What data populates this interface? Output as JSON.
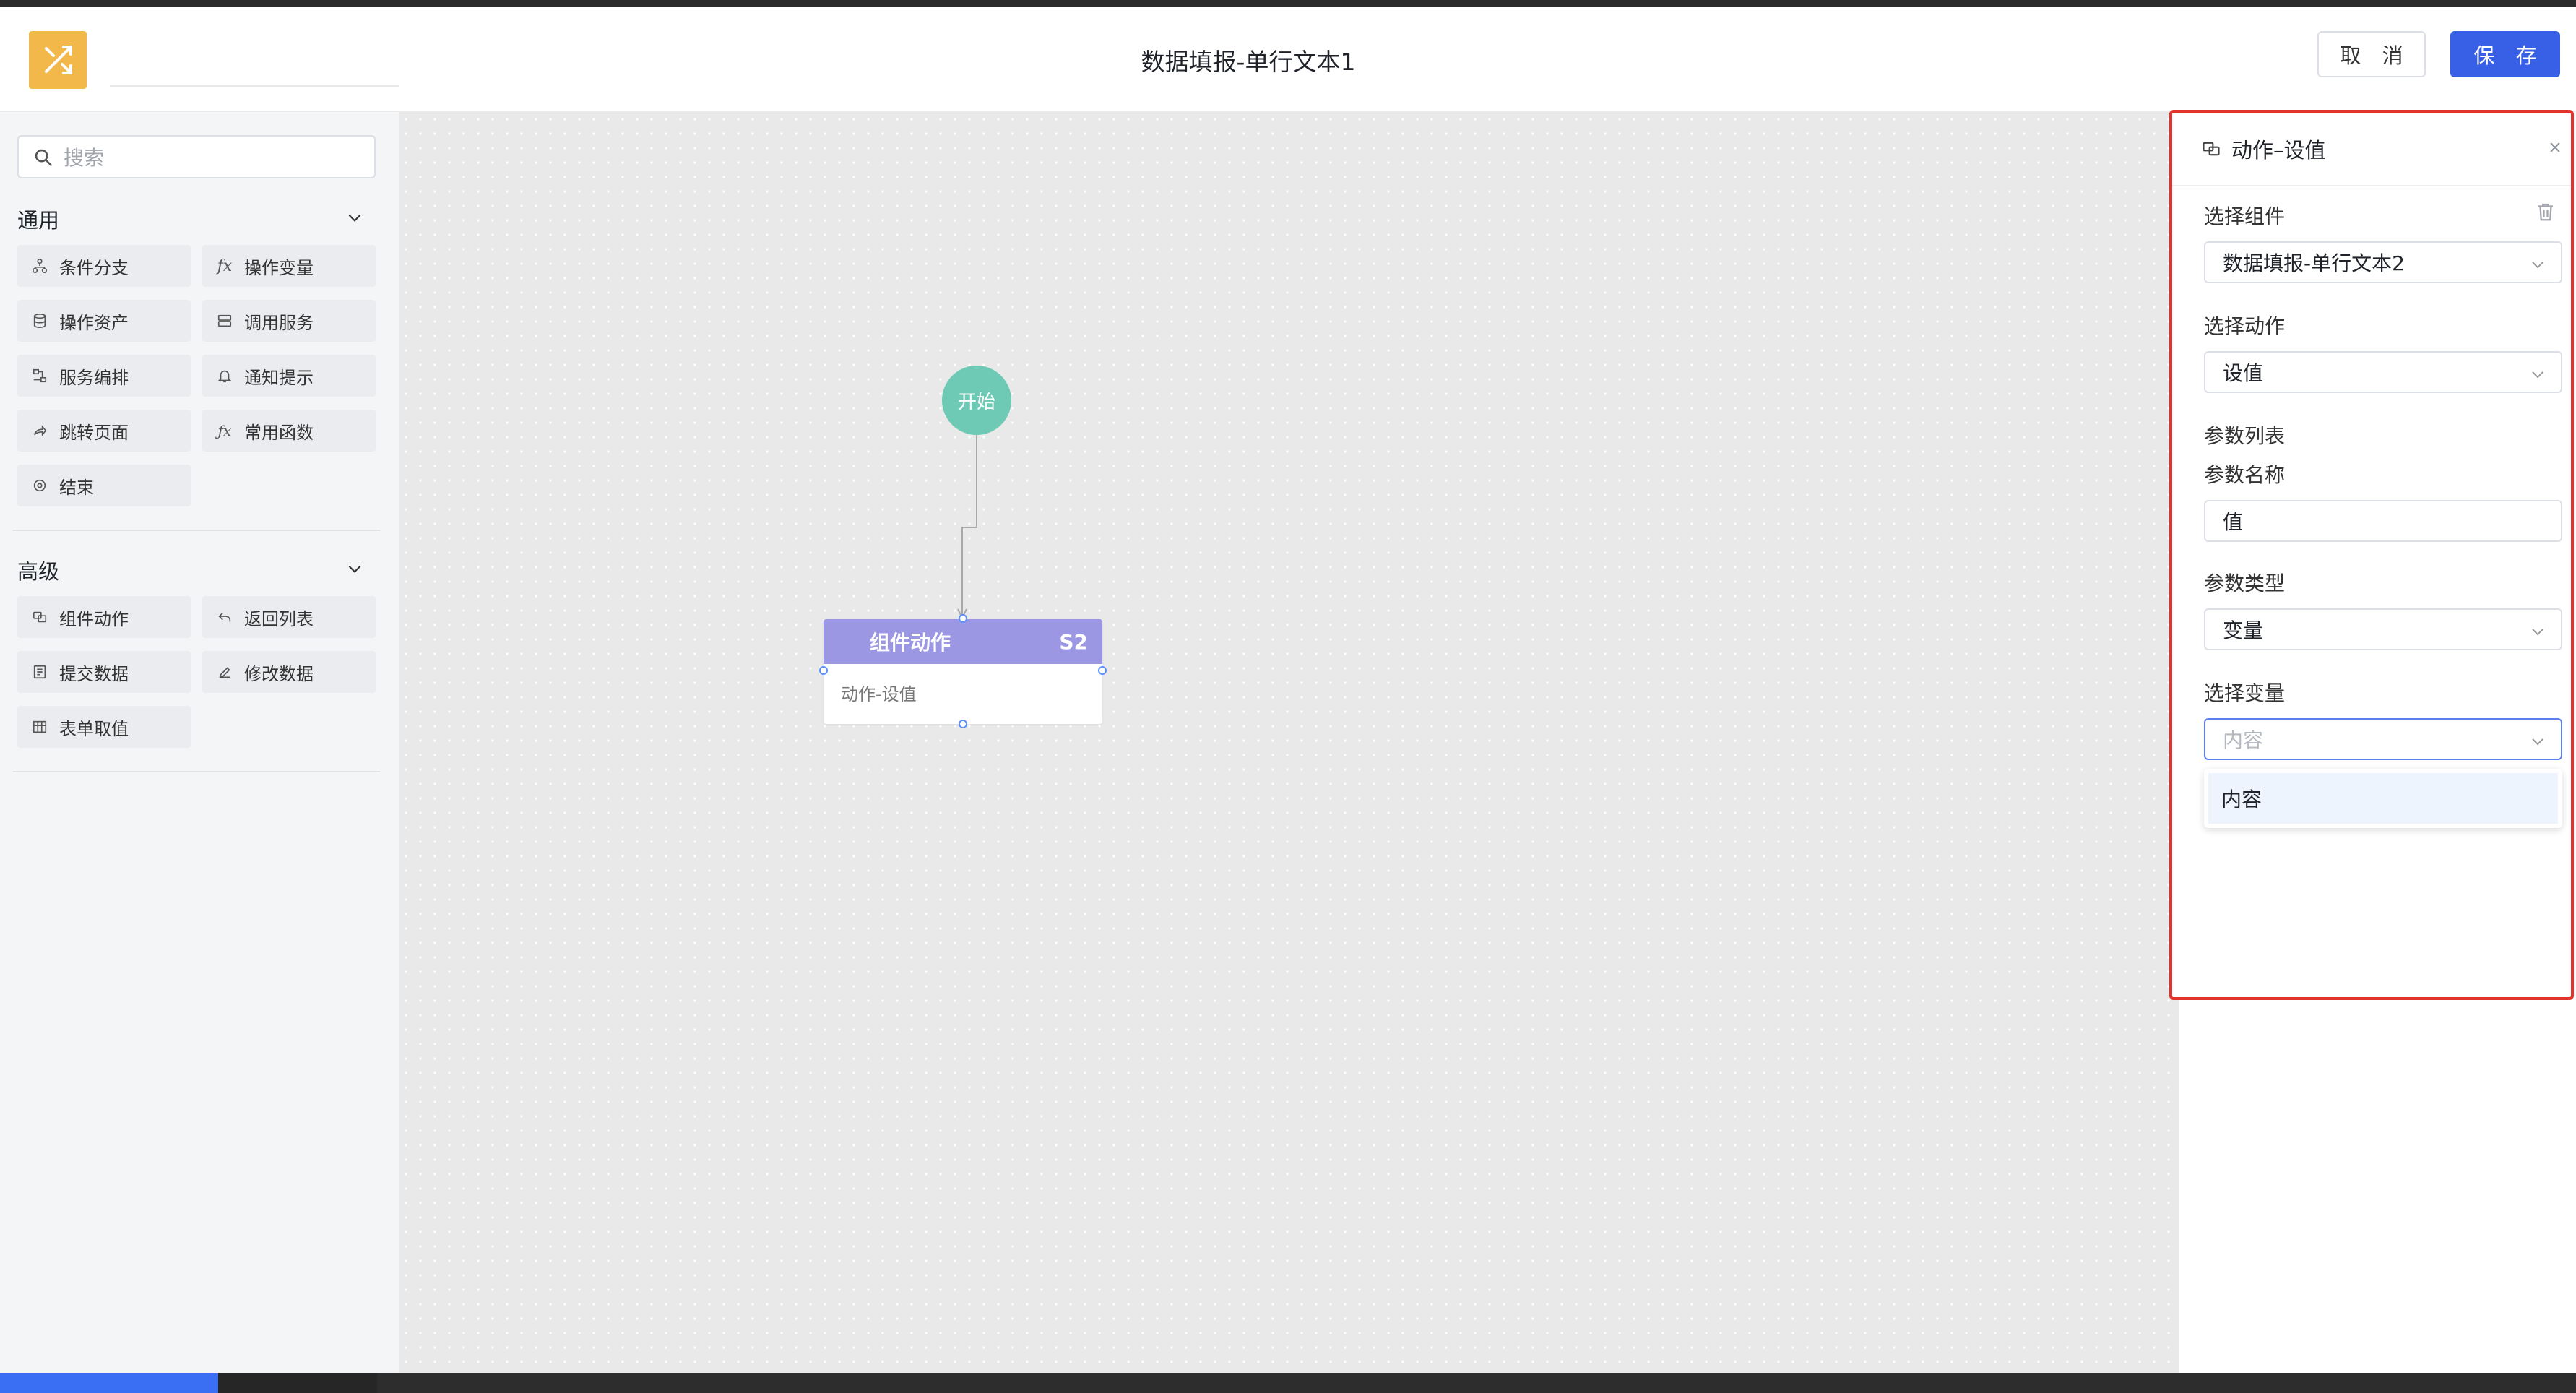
{
  "header": {
    "title": "数据填报-单行文本1",
    "cancel_label": "取 消",
    "save_label": "保 存",
    "logo_color": "#f3b84a",
    "save_color": "#3860e6"
  },
  "sidebar": {
    "search_placeholder": "搜索",
    "groups": [
      {
        "label": "通用",
        "items": [
          {
            "label": "条件分支",
            "icon": "branch-icon"
          },
          {
            "label": "操作变量",
            "icon": "fx-icon"
          },
          {
            "label": "操作资产",
            "icon": "database-icon"
          },
          {
            "label": "调用服务",
            "icon": "server-icon"
          },
          {
            "label": "服务编排",
            "icon": "orchestration-icon"
          },
          {
            "label": "通知提示",
            "icon": "bell-icon"
          },
          {
            "label": "跳转页面",
            "icon": "redirect-icon"
          },
          {
            "label": "常用函数",
            "icon": "function-icon"
          },
          {
            "label": "结束",
            "icon": "end-icon"
          }
        ]
      },
      {
        "label": "高级",
        "items": [
          {
            "label": "组件动作",
            "icon": "component-action-icon"
          },
          {
            "label": "返回列表",
            "icon": "return-icon"
          },
          {
            "label": "提交数据",
            "icon": "submit-icon"
          },
          {
            "label": "修改数据",
            "icon": "edit-icon"
          },
          {
            "label": "表单取值",
            "icon": "form-table-icon"
          }
        ]
      }
    ]
  },
  "canvas": {
    "start_label": "开始",
    "node": {
      "title": "组件动作",
      "badge": "S2",
      "subtitle": "动作-设值",
      "header_color": "#9b97e3"
    },
    "start_color": "#6fcab5"
  },
  "panel": {
    "title": "动作–设值",
    "select_component_label": "选择组件",
    "select_component_value": "数据填报-单行文本2",
    "select_action_label": "选择动作",
    "select_action_value": "设值",
    "param_list_label": "参数列表",
    "param_name_label": "参数名称",
    "param_name_value": "值",
    "param_type_label": "参数类型",
    "param_type_value": "变量",
    "select_variable_label": "选择变量",
    "select_variable_placeholder": "内容",
    "dropdown_options": [
      "内容"
    ],
    "highlight_color": "#e0332c"
  }
}
